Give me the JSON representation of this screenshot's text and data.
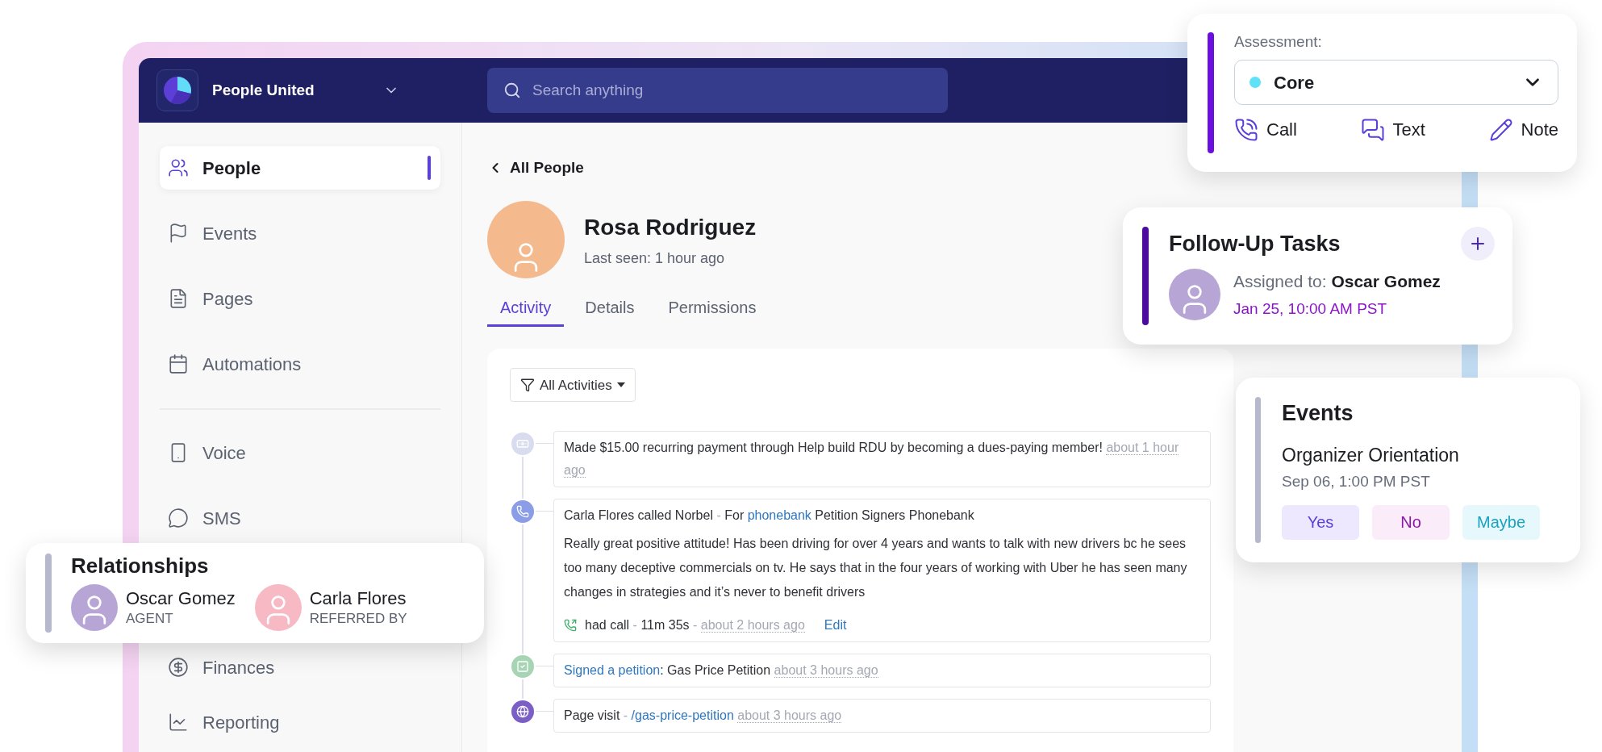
{
  "app": {
    "org_name": "People United"
  },
  "search": {
    "placeholder": "Search anything"
  },
  "sidebar": {
    "primary_items": [
      {
        "label": "People",
        "selected": true
      },
      {
        "label": "Events",
        "selected": false
      },
      {
        "label": "Pages",
        "selected": false
      },
      {
        "label": "Automations",
        "selected": false
      }
    ],
    "secondary_items": [
      {
        "label": "Voice",
        "selected": false
      },
      {
        "label": "SMS",
        "selected": false
      }
    ],
    "lower_items": [
      {
        "label": "Finances",
        "selected": false
      },
      {
        "label": "Reporting",
        "selected": false
      }
    ]
  },
  "profile": {
    "back_link": "All People",
    "name": "Rosa Rodriguez",
    "last_seen": "Last seen: 1 hour ago",
    "tabs": [
      {
        "label": "Activity",
        "selected": true
      },
      {
        "label": "Details",
        "selected": false
      },
      {
        "label": "Permissions",
        "selected": false
      }
    ]
  },
  "activity": {
    "filter": "All Activities",
    "items": [
      {
        "kind": "payment",
        "parts": [
          {
            "text": "Made $15.00 recurring payment through Help build RDU by becoming a dues-paying member!",
            "kind": "dark"
          },
          {
            "text": "about 1 hour ago",
            "kind": "time"
          }
        ]
      },
      {
        "kind": "call",
        "parts": [
          {
            "text": "Carla Flores called Norbel",
            "kind": "dark"
          },
          {
            "text": "-",
            "kind": "muted"
          },
          {
            "text": "For",
            "kind": "dark"
          },
          {
            "text": "phonebank",
            "kind": "link"
          },
          {
            "text": "Petition Signers Phonebank",
            "kind": "dark"
          }
        ],
        "note": "Really great positive attitude! Has been driving for over 4 years and wants to talk with new drivers bc he sees too many deceptive commercials on tv. He says that in the four years of working with Uber he has seen many changes in strategies and it’s never to benefit drivers",
        "footer": [
          {
            "text": "had call",
            "kind": "dark"
          },
          {
            "text": "-",
            "kind": "muted"
          },
          {
            "text": "11m 35s",
            "kind": "dark"
          },
          {
            "text": "-",
            "kind": "muted"
          },
          {
            "text": "about 2 hours ago",
            "kind": "time"
          }
        ],
        "action": "Edit"
      },
      {
        "kind": "petition",
        "parts": [
          {
            "text": "Signed a petition",
            "kind": "link"
          },
          {
            "text": ": Gas Price Petition",
            "kind": "tail"
          },
          {
            "text": "about 3 hours ago",
            "kind": "time"
          }
        ]
      },
      {
        "kind": "visit",
        "parts": [
          {
            "text": "Page visit",
            "kind": "dark"
          },
          {
            "text": "-",
            "kind": "muted"
          },
          {
            "text": "/gas-price-petition",
            "kind": "link"
          },
          {
            "text": "about 3 hours ago",
            "kind": "time"
          }
        ]
      }
    ]
  },
  "assessment": {
    "label": "Assessment:",
    "value": "Core",
    "color": "#5fe1f7",
    "actions": [
      "Call",
      "Text",
      "Note"
    ]
  },
  "follow_up": {
    "title": "Follow-Up Tasks",
    "assigned_label": "Assigned to:",
    "assignee": "Oscar Gomez",
    "due": "Jan 25, 10:00 AM PST"
  },
  "events_card": {
    "title": "Events",
    "event": "Organizer Orientation",
    "time": "Sep 06, 1:00 PM PST",
    "rsvp": [
      {
        "label": "Yes",
        "kind": "yes"
      },
      {
        "label": "No",
        "kind": "no"
      },
      {
        "label": "Maybe",
        "kind": "maybe"
      }
    ]
  },
  "relationships": {
    "title": "Relationships",
    "people": [
      {
        "name": "Oscar Gomez",
        "role": "AGENT"
      },
      {
        "name": "Carla Flores",
        "role": "REFERRED BY"
      }
    ]
  }
}
